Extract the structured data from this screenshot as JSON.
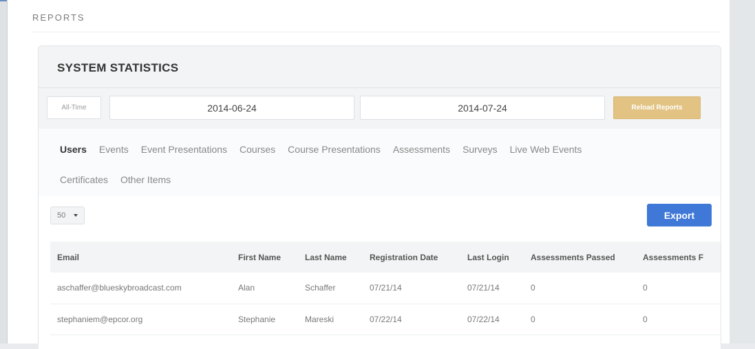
{
  "page": {
    "heading": "REPORTS"
  },
  "panel": {
    "title": "SYSTEM STATISTICS",
    "all_time_label": "All-Time",
    "start_date": "2014-06-24",
    "end_date": "2014-07-24",
    "reload_label": "Reload Reports"
  },
  "tabs": {
    "row1": [
      "Users",
      "Events",
      "Event Presentations",
      "Courses",
      "Course Presentations",
      "Assessments",
      "Surveys",
      "Live Web Events"
    ],
    "row2": [
      "Certificates",
      "Other Items"
    ],
    "active": "Users"
  },
  "toolbar": {
    "page_size": "50",
    "export_label": "Export"
  },
  "table": {
    "columns": [
      "Email",
      "First Name",
      "Last Name",
      "Registration Date",
      "Last Login",
      "Assessments Passed",
      "Assessments F"
    ],
    "rows": [
      [
        "aschaffer@blueskybroadcast.com",
        "Alan",
        "Schaffer",
        "07/21/14",
        "07/21/14",
        "0",
        "0"
      ],
      [
        "stephaniem@epcor.org",
        "Stephanie",
        "Mareski",
        "07/22/14",
        "07/22/14",
        "0",
        "0"
      ]
    ]
  },
  "colors": {
    "accent": "#3f78d6",
    "reload": "#e2c384",
    "top_border": "#6a8cc4"
  }
}
